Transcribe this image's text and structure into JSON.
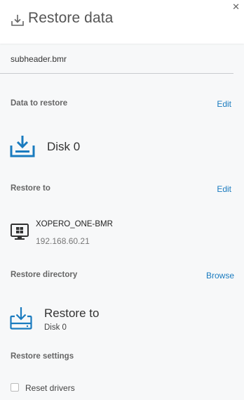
{
  "header": {
    "title": "Restore data",
    "close_icon": "close-icon",
    "title_icon": "download-tray-icon"
  },
  "subheader": "subheader.bmr",
  "data_to_restore": {
    "label": "Data to restore",
    "action": "Edit",
    "item": "Disk 0",
    "icon": "download-tray-icon"
  },
  "restore_to": {
    "label": "Restore to",
    "action": "Edit",
    "host_name": "XOPERO_ONE-BMR",
    "host_ip": "192.168.60.21",
    "icon": "windows-monitor-icon"
  },
  "restore_directory": {
    "label": "Restore directory",
    "action": "Browse",
    "title": "Restore to",
    "subtitle": "Disk 0",
    "icon": "download-drive-icon"
  },
  "restore_settings": {
    "label": "Restore settings",
    "options": [
      {
        "label": "Reset drivers",
        "checked": false
      }
    ]
  },
  "colors": {
    "accent": "#1a7bbf",
    "background": "#f7f8f9",
    "header_bg": "#ffffff"
  }
}
